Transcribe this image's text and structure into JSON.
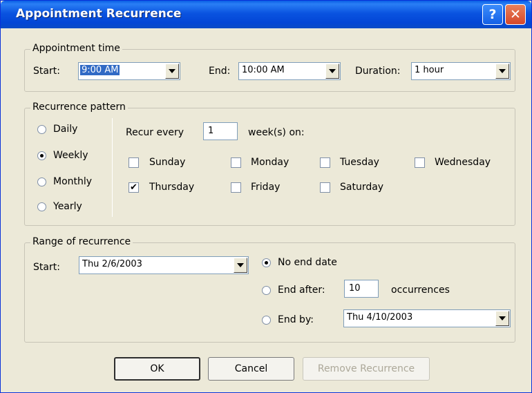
{
  "window": {
    "title": "Appointment Recurrence",
    "help_glyph": "?",
    "close_glyph": "✕"
  },
  "appointment_time": {
    "legend": "Appointment time",
    "start_label": "Start:",
    "start_value": "9:00 AM",
    "end_label": "End:",
    "end_value": "10:00 AM",
    "duration_label": "Duration:",
    "duration_value": "1 hour"
  },
  "recurrence_pattern": {
    "legend": "Recurrence pattern",
    "options": [
      "Daily",
      "Weekly",
      "Monthly",
      "Yearly"
    ],
    "selected": "Weekly",
    "recur_every_label": "Recur every",
    "recur_every_value": "1",
    "weeks_on_label": "week(s) on:",
    "days": [
      {
        "label": "Sunday",
        "checked": false
      },
      {
        "label": "Monday",
        "checked": false
      },
      {
        "label": "Tuesday",
        "checked": false
      },
      {
        "label": "Wednesday",
        "checked": false
      },
      {
        "label": "Thursday",
        "checked": true
      },
      {
        "label": "Friday",
        "checked": false
      },
      {
        "label": "Saturday",
        "checked": false
      }
    ],
    "check_glyph": "✔"
  },
  "range": {
    "legend": "Range of recurrence",
    "start_label": "Start:",
    "start_value": "Thu 2/6/2003",
    "no_end_label": "No end date",
    "end_after_label": "End after:",
    "end_after_value": "10",
    "occurrences_label": "occurrences",
    "end_by_label": "End by:",
    "end_by_value": "Thu 4/10/2003",
    "selected": "No end date"
  },
  "buttons": {
    "ok": "OK",
    "cancel": "Cancel",
    "remove": "Remove Recurrence"
  }
}
